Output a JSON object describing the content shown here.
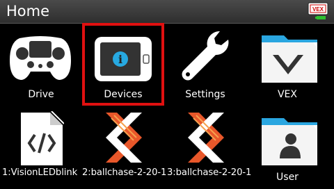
{
  "header": {
    "title": "Home",
    "brain_logo": "VEX"
  },
  "tiles": [
    {
      "label": "Drive",
      "icon": "controller-icon"
    },
    {
      "label": "Devices",
      "icon": "brain-device-icon",
      "selected": true
    },
    {
      "label": "Settings",
      "icon": "wrench-icon"
    },
    {
      "label": "VEX",
      "icon": "vex-folder-icon"
    },
    {
      "label": "",
      "icon": "code-file-icon"
    },
    {
      "label": "",
      "icon": "program-icon"
    },
    {
      "label": "",
      "icon": "program-icon"
    },
    {
      "label": "User",
      "icon": "user-folder-icon"
    }
  ],
  "programs": {
    "slot1": "1:VisionLEDblink",
    "slot2": "2:ballchase-2-20-1",
    "slot3": "3:ballchase-2-20-1"
  },
  "colors": {
    "selection": "#e01010",
    "accent_cyan": "#27a9e1",
    "folder_blue": "#2aa6e0",
    "program_orange": "#e8572a"
  }
}
